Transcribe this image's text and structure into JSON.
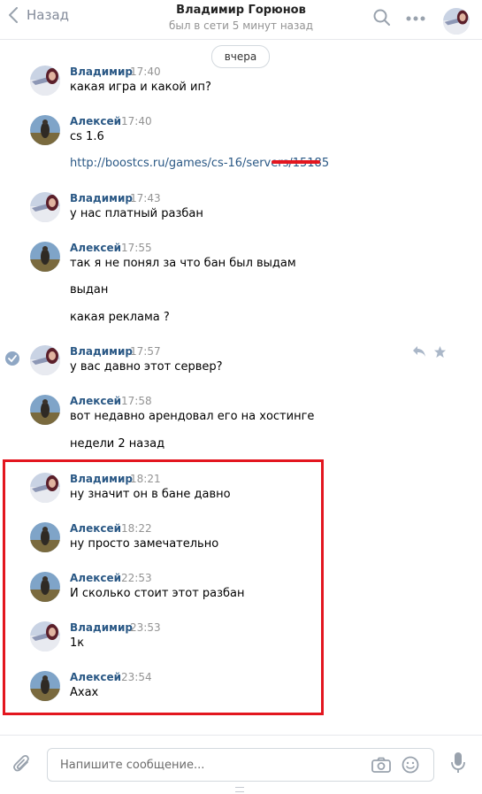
{
  "header": {
    "back_label": "Назад",
    "title": "Владимир Горюнов",
    "status": "был в сети 5 минут назад"
  },
  "date_divider": "вчера",
  "messages": [
    {
      "author": "Владимир",
      "time": "17:40",
      "lines": [
        "какая игра и какой ип?"
      ]
    },
    {
      "author": "Алексей",
      "time": "17:40",
      "lines": [
        "cs 1.6",
        "http://boostcs.ru/games/cs-16/servers/15185"
      ]
    },
    {
      "author": "Владимир",
      "time": "17:43",
      "lines": [
        "у нас платный разбан"
      ]
    },
    {
      "author": "Алексей",
      "time": "17:55",
      "lines": [
        "так я не понял за что бан был выдам",
        "выдан",
        "какая реклама ?"
      ]
    },
    {
      "author": "Владимир",
      "time": "17:57",
      "lines": [
        "у вас давно этот сервер?"
      ]
    },
    {
      "author": "Алексей",
      "time": "17:58",
      "lines": [
        "вот недавно арендовал его на хостинге",
        "недели 2 назад"
      ]
    },
    {
      "author": "Владимир",
      "time": "18:21",
      "lines": [
        "ну значит он в бане давно"
      ]
    },
    {
      "author": "Алексей",
      "time": "18:22",
      "lines": [
        "ну просто замечательно"
      ]
    },
    {
      "author": "Алексей",
      "time": "22:53",
      "lines": [
        "И сколько стоит этот разбан"
      ]
    },
    {
      "author": "Владимир",
      "time": "23:53",
      "lines": [
        "1к"
      ]
    },
    {
      "author": "Алексей",
      "time": "23:54",
      "lines": [
        "Ахах"
      ]
    }
  ],
  "composer": {
    "placeholder": "Напишите сообщение..."
  },
  "colors": {
    "name_blue": "#2a5885",
    "highlight_red": "#e3161f",
    "muted_gray": "#939393"
  }
}
